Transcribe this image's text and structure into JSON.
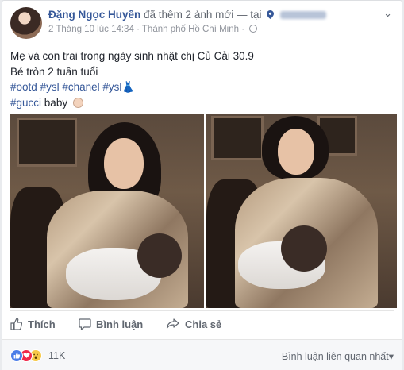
{
  "post": {
    "author": "Đặng Ngọc Huyền",
    "action": "đã thêm 2 ảnh mới",
    "dash_at": "— tại",
    "date": "2 Tháng 10 lúc 14:34",
    "location": "Thành phố Hồ Chí Minh",
    "separator": "·",
    "text_line1": "Mẹ và con trai trong ngày sinh nhật chị Củ Cải 30.9",
    "text_line2": "Bé tròn 2 tuần tuổi",
    "hashtags_line3": [
      "#ootd",
      "#ysl",
      "#chanel",
      "#ysl"
    ],
    "hashtags_line4": "#gucci",
    "line4_suffix": "baby",
    "dress_emoji": "👗",
    "chevron": "⌄"
  },
  "actions": {
    "like": "Thích",
    "comment": "Bình luận",
    "share": "Chia sẻ"
  },
  "reactions": {
    "count": "11K",
    "sort_label": "Bình luận liên quan nhất",
    "sort_caret": "▾",
    "icons": [
      "like-icon",
      "love-icon",
      "wow-icon"
    ]
  },
  "colors": {
    "link": "#365899",
    "muted": "#616770",
    "like": "#4b7de8",
    "love": "#f0284a",
    "wow": "#f7c948"
  }
}
